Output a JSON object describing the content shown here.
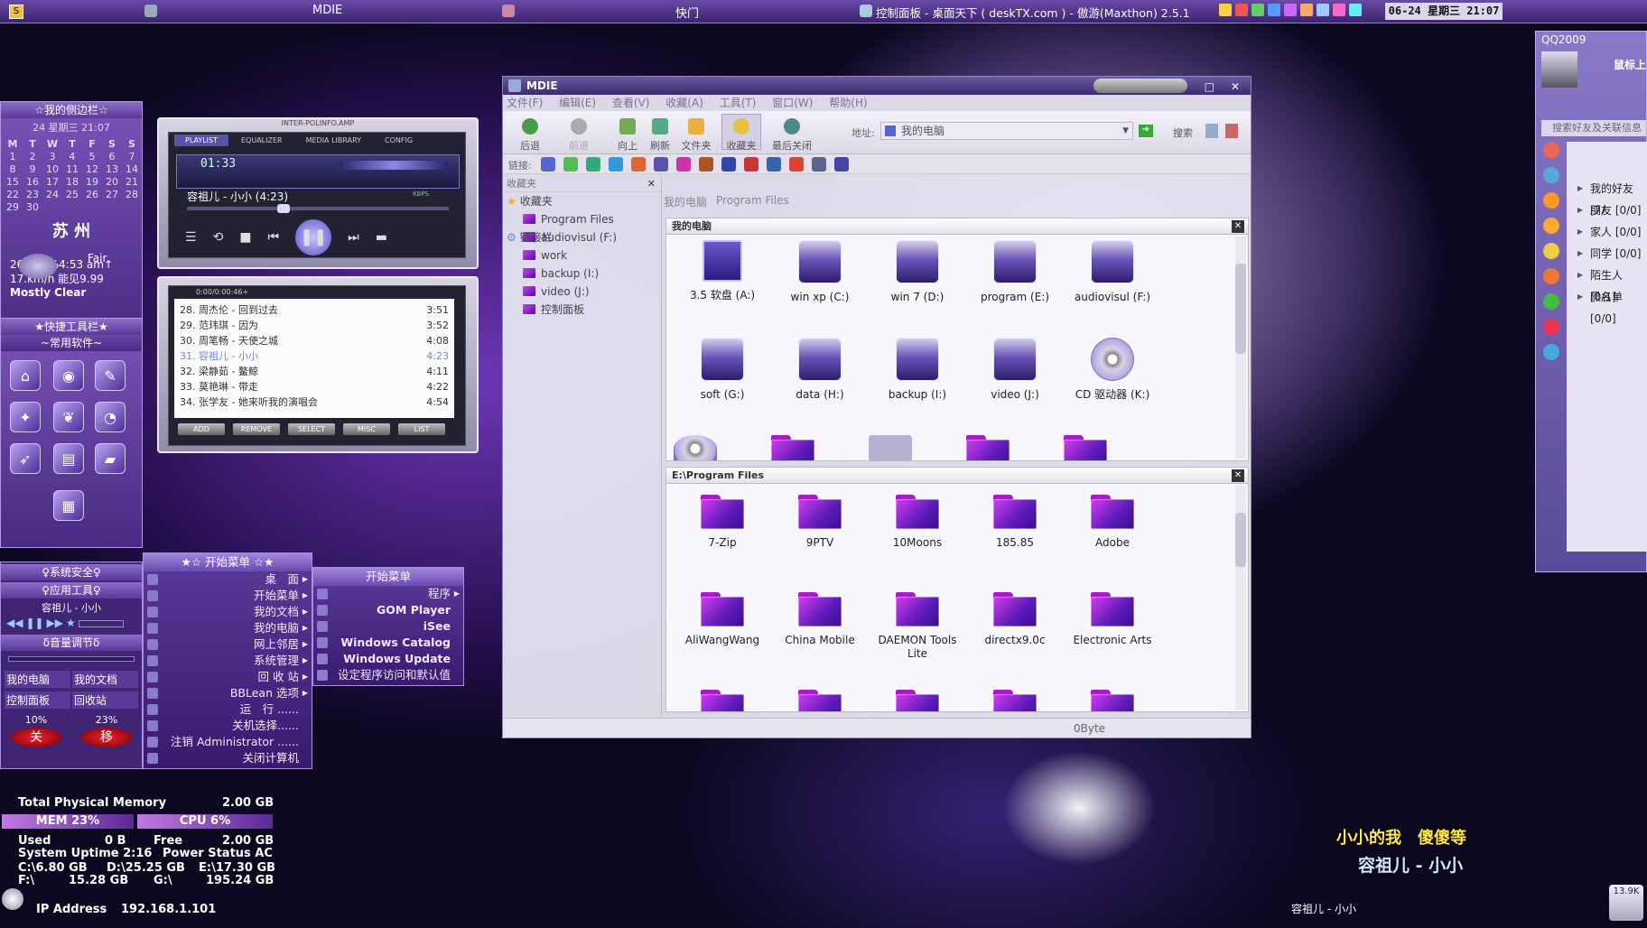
{
  "topbar": {
    "left_title": "MDIE",
    "center_title": "快门",
    "browser_title": "控制面板 - 桌面天下 ( deskTX.com ) - 傲游(Maxthon) 2.5.1",
    "clock": "06-24 星期三 21:07"
  },
  "sidebar": {
    "title": "☆我的侧边栏☆",
    "date_line": "24 星期三 21:07",
    "weekdays": [
      "M",
      "T",
      "W",
      "T",
      "F",
      "S",
      "S"
    ],
    "calendar_rows": [
      [
        "1",
        "2",
        "3",
        "4",
        "5",
        "6",
        "7"
      ],
      [
        "8",
        "9",
        "10",
        "11",
        "12",
        "13",
        "14"
      ],
      [
        "15",
        "16",
        "17",
        "18",
        "19",
        "20",
        "21"
      ],
      [
        "22",
        "23",
        "24",
        "25",
        "26",
        "27",
        "28"
      ],
      [
        "29",
        "30",
        "",
        "",
        "",
        "",
        ""
      ]
    ],
    "weather": {
      "city": "苏 州",
      "condition": "Fair",
      "line1": "26C  69%4:53 am↑",
      "line2": "17.km/h  能见9.99",
      "line3": "Mostly Clear"
    },
    "quick_tools_title": "★快捷工具栏★",
    "common_software_title": "~常用软件~",
    "system_security": "♀系统安全♀",
    "app_tools": "♀应用工具♀",
    "now_playing": "容祖儿 - 小小",
    "volume_title": "δ音量调节δ",
    "shortcuts": [
      "我的电脑",
      "我的文档",
      "控制面板",
      "回收站"
    ],
    "percent_left": "10%",
    "percent_right": "23%",
    "btn_shutdown": "关",
    "btn_restart": "移"
  },
  "player": {
    "skin_title": "INTER-POLINFO.AMP",
    "tabs": [
      "PLAYLIST",
      "EQUALIZER",
      "MEDIA LIBRARY",
      "CONFIG"
    ],
    "time": "01:33",
    "track": "容祖儿 - 小小 (4:23)",
    "bitrate": "KBPS",
    "playlist_header": "0:00/0:00:46+",
    "playlist": [
      {
        "title": "28. 周杰伦 - 回到过去",
        "time": "3:51"
      },
      {
        "title": "29. 范玮琪 - 因为",
        "time": "3:52"
      },
      {
        "title": "30. 周笔畅 - 天使之城",
        "time": "4:08"
      },
      {
        "title": "31. 容祖儿 - 小小",
        "time": "4:23"
      },
      {
        "title": "32. 梁静茹 - 鳌鲸",
        "time": "4:11"
      },
      {
        "title": "33. 莫艳琳 - 带走",
        "time": "4:22"
      },
      {
        "title": "34. 张学友 - 她来听我的演唱会",
        "time": "4:54"
      }
    ],
    "buttons": [
      "ADD",
      "REMOVE",
      "SELECT",
      "MISC",
      "LIST"
    ]
  },
  "startmenu": {
    "header": "★☆ 开始菜单 ☆★",
    "items": [
      "桌　面",
      "开始菜单",
      "我的文档",
      "我的电脑",
      "网上邻居",
      "系统管理",
      "回 收 站",
      "BBLean 选项",
      "运　行 ......",
      "关机选择......",
      "注销 Administrator ......",
      "关闭计算机"
    ],
    "sub_header": "开始菜单",
    "sub_items": [
      "程序",
      "GOM Player",
      "iSee",
      "Windows Catalog",
      "Windows Update",
      "设定程序访问和默认值"
    ]
  },
  "window": {
    "title": "MDIE",
    "menu": [
      "文件(F)",
      "编辑(E)",
      "查看(V)",
      "收藏(A)",
      "工具(T)",
      "窗口(W)",
      "帮助(H)"
    ],
    "toolbar": [
      "后退",
      "前进",
      "向上",
      "刷新",
      "文件夹",
      "收藏夹",
      "最后关闭"
    ],
    "address_label": "地址:",
    "address_value": "我的电脑",
    "search_label": "搜索",
    "links_label": "链接:",
    "favorites_label": "收藏夹",
    "tabs": [
      "我的电脑",
      "Program Files"
    ],
    "tree": {
      "root": "收藏夹",
      "items": [
        "Program Files",
        "audiovisul (F:)",
        "work",
        "backup (I:)",
        "video (J:)",
        "控制面板"
      ],
      "links": "链接栏"
    },
    "pane1": {
      "title": "我的电脑",
      "items": [
        {
          "label": "3.5 软盘 (A:)",
          "icon": "floppy-icon"
        },
        {
          "label": "win xp (C:)",
          "icon": "drive-icon"
        },
        {
          "label": "win 7 (D:)",
          "icon": "drive-icon"
        },
        {
          "label": "program (E:)",
          "icon": "drive-icon"
        },
        {
          "label": "audiovisul (F:)",
          "icon": "drive-icon"
        },
        {
          "label": "soft (G:)",
          "icon": "drive-icon"
        },
        {
          "label": "data (H:)",
          "icon": "drive-icon"
        },
        {
          "label": "backup (I:)",
          "icon": "drive-icon"
        },
        {
          "label": "video (J:)",
          "icon": "drive-icon"
        },
        {
          "label": "CD 驱动器 (K:)",
          "icon": "cd-icon"
        }
      ]
    },
    "pane2": {
      "title": "E:\\Program Files",
      "items": [
        "7-Zip",
        "9PTV",
        "10Moons",
        "185.85",
        "Adobe",
        "AliWangWang",
        "China Mobile",
        "DAEMON Tools Lite",
        "directx9.0c",
        "Electronic Arts"
      ]
    },
    "status": "0Byte"
  },
  "qq": {
    "title": "QQ2009",
    "nick": "鼠标上",
    "search_placeholder": "搜索好友及关联信息",
    "groups": [
      "我的好友 [7/",
      "朋友 [0/0]",
      "家人 [0/0]",
      "同学 [0/0]",
      "陌生人 [0/1]",
      "黑名单 [0/0]"
    ]
  },
  "sysmon": {
    "total_label": "Total Physical Memory",
    "total_value": "2.00 GB",
    "mem": "MEM 23%",
    "cpu": "CPU 6%",
    "used_label": "Used",
    "used_value": "0 B",
    "free_label": "Free",
    "free_value": "2.00 GB",
    "uptime": "System Uptime 2:16",
    "power": "Power Status  AC",
    "drive_c": "C:\\6.80 GB",
    "drive_d": "D:\\25.25 GB",
    "drive_e": "E:\\17.30 GB",
    "drive_f": "F:\\",
    "drive_f_value": "15.28 GB",
    "drive_g": "G:\\",
    "drive_g_value": "195.24 GB",
    "ip_label": "IP Address",
    "ip_value": "192.168.1.101"
  },
  "lyrics": {
    "line1": "小小的我　傻傻等",
    "line2": "容祖儿 - 小小",
    "caption": "容祖儿 - 小小"
  },
  "tray_badge": "13.9K",
  "colors": {
    "accent": "#6a4aa8",
    "folder": "#c02ee0",
    "lyric_yellow": "#ffe84a",
    "lyric_cyan": "#cfe8ff"
  }
}
